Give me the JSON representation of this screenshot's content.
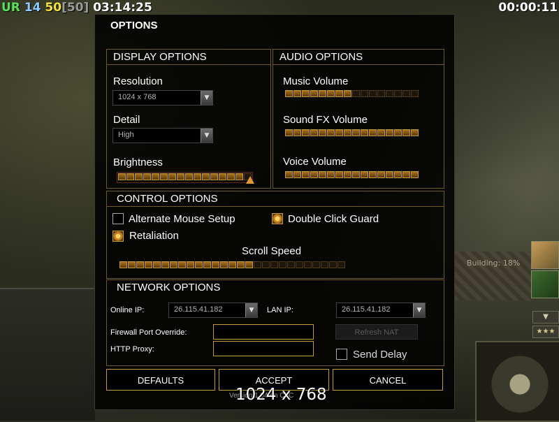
{
  "hud": {
    "faction": "UR",
    "power": "14",
    "units": "50",
    "units_max": "[50]",
    "mission_time": "03:14:25",
    "game_timer": "00:00:11"
  },
  "game": {
    "building_status": "Building: 18%",
    "rank_stars": "★★★"
  },
  "dialog": {
    "title": "OPTIONS",
    "display": {
      "header": "DISPLAY OPTIONS",
      "resolution_label": "Resolution",
      "resolution_value": "1024 x 768",
      "detail_label": "Detail",
      "detail_value": "High",
      "brightness_label": "Brightness",
      "brightness_level": 0.96
    },
    "audio": {
      "header": "AUDIO OPTIONS",
      "music_label": "Music Volume",
      "music_level": 0.5,
      "sfx_label": "Sound FX Volume",
      "sfx_level": 1.0,
      "voice_label": "Voice Volume",
      "voice_level": 1.0
    },
    "control": {
      "header": "CONTROL OPTIONS",
      "alt_mouse_label": "Alternate Mouse Setup",
      "alt_mouse_checked": false,
      "double_click_label": "Double Click Guard",
      "double_click_checked": true,
      "retaliation_label": "Retaliation",
      "retaliation_checked": true,
      "scroll_label": "Scroll Speed",
      "scroll_level": 0.6
    },
    "network": {
      "header": "NETWORK OPTIONS",
      "online_ip_label": "Online IP:",
      "online_ip_value": "26.115.41.182",
      "lan_ip_label": "LAN IP:",
      "lan_ip_value": "26.115.41.182",
      "firewall_label": "Firewall Port Override:",
      "firewall_value": "",
      "proxy_label": "HTTP Proxy:",
      "proxy_value": "",
      "refresh_nat_label": "Refresh NAT",
      "send_delay_label": "Send Delay",
      "send_delay_checked": false
    },
    "buttons": {
      "defaults": "DEFAULTS",
      "accept": "ACCEPT",
      "cancel": "CANCEL"
    },
    "version_text": "Version 1.04 on CnC",
    "resolution_overlay": "1024 x 768"
  },
  "colors": {
    "accent_gold": "#c49a3a",
    "slider_fill": "#a86f1c",
    "faction_green": "#59e15a",
    "power_blue": "#8ec9ff",
    "units_yellow": "#f2e33a"
  }
}
